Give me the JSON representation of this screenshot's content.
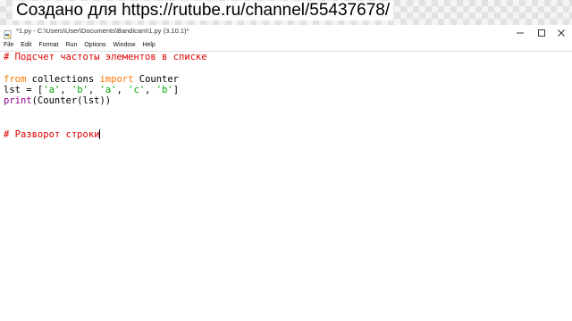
{
  "banner": {
    "text": "Создано для https://rutube.ru/channel/55437678/"
  },
  "window": {
    "title": "*1.py - C:\\Users\\User\\Documents\\Bandicam\\1.py (3.10.1)*",
    "icon": "python-file-icon",
    "controls": [
      "minimize-icon",
      "maximize-icon",
      "close-icon"
    ]
  },
  "menu": {
    "items": [
      "File",
      "Edit",
      "Format",
      "Run",
      "Options",
      "Window",
      "Help"
    ]
  },
  "code": {
    "line1_comment": "# Подсчет частоты элементов в списке",
    "line3_kw_from": "from",
    "line3_mid": " collections ",
    "line3_kw_import": "import",
    "line3_end": " Counter",
    "line4_a": "lst = [",
    "line4_s1": "'a'",
    "line4_c1": ", ",
    "line4_s2": "'b'",
    "line4_c2": ", ",
    "line4_s3": "'a'",
    "line4_c3": ", ",
    "line4_s4": "'c'",
    "line4_c4": ", ",
    "line4_s5": "'b'",
    "line4_z": "]",
    "line5_print": "print",
    "line5_rest": "(Counter(lst))",
    "line8_comment": "# Разворот строки"
  },
  "colors": {
    "keyword": "#ff7700",
    "builtin": "#900090",
    "string": "#00aa00",
    "comment": "#dd0000"
  }
}
